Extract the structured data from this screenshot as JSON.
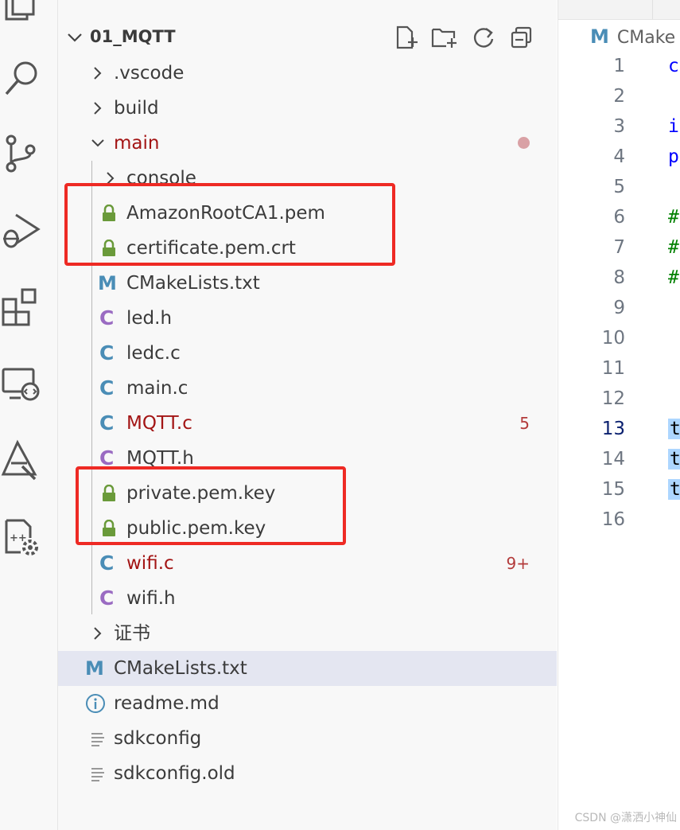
{
  "activity_bar": [
    "explorer-icon",
    "search-icon",
    "source-control-icon",
    "run-debug-icon",
    "extensions-icon",
    "remote-explorer-icon",
    "testing-icon",
    "cmake-tools-icon"
  ],
  "explorer": {
    "folder_title": "01_MQTT",
    "items": [
      {
        "label": ".vscode",
        "kind": "folder",
        "state": "collapsed"
      },
      {
        "label": "build",
        "kind": "folder",
        "state": "collapsed"
      },
      {
        "label": "main",
        "kind": "folder",
        "state": "expanded",
        "modified": true
      },
      {
        "label": "console",
        "kind": "folder",
        "state": "collapsed"
      },
      {
        "label": "AmazonRootCA1.pem",
        "kind": "lock"
      },
      {
        "label": "certificate.pem.crt",
        "kind": "lock"
      },
      {
        "label": "CMakeLists.txt",
        "kind": "cmake"
      },
      {
        "label": "led.h",
        "kind": "c-header"
      },
      {
        "label": "ledc.c",
        "kind": "c-source"
      },
      {
        "label": "main.c",
        "kind": "c-source"
      },
      {
        "label": "MQTT.c",
        "kind": "c-source",
        "badge": "5"
      },
      {
        "label": "MQTT.h",
        "kind": "c-header"
      },
      {
        "label": "private.pem.key",
        "kind": "lock"
      },
      {
        "label": "public.pem.key",
        "kind": "lock"
      },
      {
        "label": "wifi.c",
        "kind": "c-source",
        "badge": "9+"
      },
      {
        "label": "wifi.h",
        "kind": "c-header"
      },
      {
        "label": "证书",
        "kind": "folder",
        "state": "collapsed"
      },
      {
        "label": "CMakeLists.txt",
        "kind": "cmake",
        "selected": true
      },
      {
        "label": "readme.md",
        "kind": "info"
      },
      {
        "label": "sdkconfig",
        "kind": "text"
      },
      {
        "label": "sdkconfig.old",
        "kind": "text"
      }
    ],
    "icon_letters": {
      "c": "C",
      "cmake": "M"
    },
    "colors": {
      "error_text": "#a31515",
      "lock_green": "#6a9a3a",
      "c_blue": "#4a8db6",
      "c_purple": "#9a6bc2",
      "highlight_box": "#ee2a24",
      "selected_row": "#e4e6f1"
    }
  },
  "editor": {
    "breadcrumb": "CMake",
    "breadcrumb_icon": "M",
    "line_numbers": [
      "1",
      "2",
      "3",
      "4",
      "5",
      "6",
      "7",
      "8",
      "9",
      "10",
      "11",
      "12",
      "13",
      "14",
      "15",
      "16"
    ],
    "active_line": "13",
    "code_lines": [
      {
        "line": "1",
        "text": "cr",
        "style": "kw"
      },
      {
        "line": "3",
        "text": "i",
        "style": "kw"
      },
      {
        "line": "4",
        "text": "p",
        "style": "kw"
      },
      {
        "line": "6",
        "text": "#",
        "style": "cm"
      },
      {
        "line": "7",
        "text": "#",
        "style": "cm"
      },
      {
        "line": "8",
        "text": "#",
        "style": "cm"
      },
      {
        "line": "13",
        "text": "t",
        "style": "sel"
      },
      {
        "line": "14",
        "text": "t",
        "style": "sel"
      },
      {
        "line": "15",
        "text": "t",
        "style": "sel"
      }
    ]
  },
  "watermark": "CSDN @潇洒小神仙"
}
